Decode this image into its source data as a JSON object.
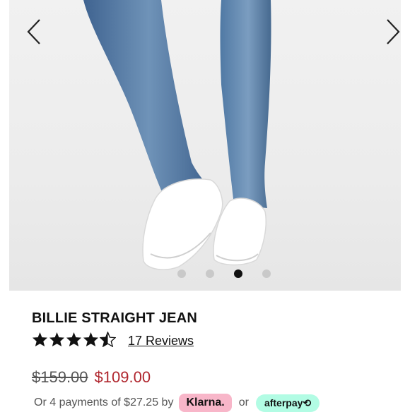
{
  "gallery": {
    "prev_icon": "chevron-left-icon",
    "next_icon": "chevron-right-icon",
    "dot_count": 4,
    "active_dot": 3
  },
  "product": {
    "title": "BILLIE STRAIGHT JEAN",
    "rating": 4.5,
    "rating_max": 5,
    "reviews_label": "17 Reviews",
    "original_price": "$159.00",
    "sale_price": "$109.00"
  },
  "payment": {
    "text": "Or 4 payments of $27.25 by",
    "klarna_label": "Klarna.",
    "or_label": "or",
    "afterpay_label": "afterpay⟲"
  },
  "colors": {
    "sale_price": "#b0262e",
    "klarna": "#f8b6c9",
    "afterpay": "#b2fce4",
    "denim": "#4a6f97"
  }
}
